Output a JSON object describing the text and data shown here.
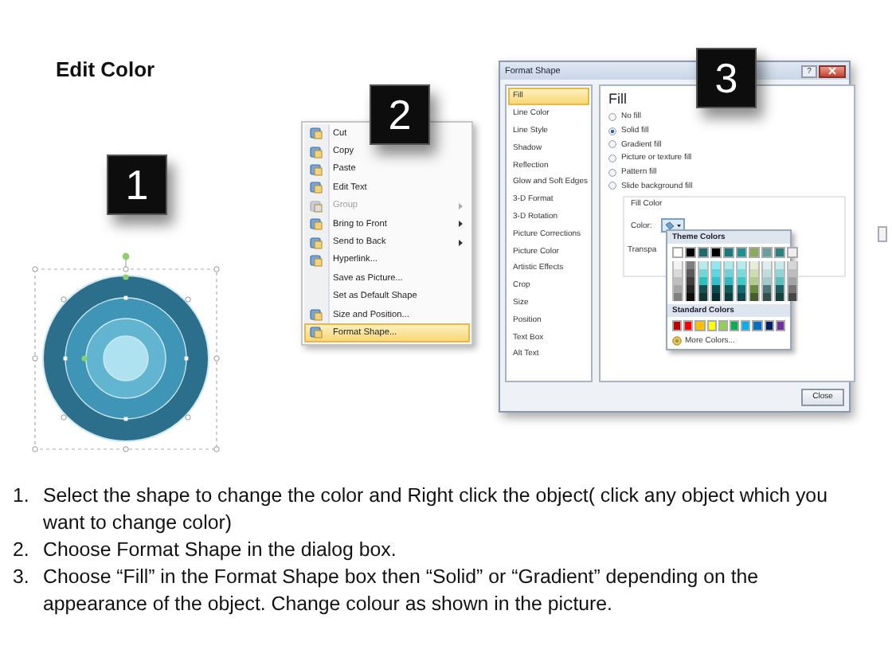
{
  "title": "Edit Color",
  "steps": [
    {
      "number": "1"
    },
    {
      "number": "2"
    },
    {
      "number": "3"
    }
  ],
  "context_menu": {
    "items": [
      {
        "label": "Cut",
        "icon": true,
        "disabled": false,
        "submenu": false,
        "selected": false
      },
      {
        "label": "Copy",
        "icon": true,
        "disabled": false,
        "submenu": false,
        "selected": false
      },
      {
        "label": "Paste",
        "icon": true,
        "disabled": false,
        "submenu": false,
        "selected": false
      },
      {
        "label": "Edit Text",
        "icon": true,
        "disabled": false,
        "submenu": false,
        "selected": false
      },
      {
        "label": "Group",
        "icon": true,
        "disabled": true,
        "submenu": true,
        "selected": false
      },
      {
        "label": "Bring to Front",
        "icon": true,
        "disabled": false,
        "submenu": true,
        "selected": false
      },
      {
        "label": "Send to Back",
        "icon": true,
        "disabled": false,
        "submenu": true,
        "selected": false
      },
      {
        "label": "Hyperlink...",
        "icon": true,
        "disabled": false,
        "submenu": false,
        "selected": false
      },
      {
        "label": "Save as Picture...",
        "icon": false,
        "disabled": false,
        "submenu": false,
        "selected": false
      },
      {
        "label": "Set as Default Shape",
        "icon": false,
        "disabled": false,
        "submenu": false,
        "selected": false
      },
      {
        "label": "Size and Position...",
        "icon": true,
        "disabled": false,
        "submenu": false,
        "selected": false
      },
      {
        "label": "Format Shape...",
        "icon": true,
        "disabled": false,
        "submenu": false,
        "selected": true
      }
    ]
  },
  "dialog": {
    "title": "Format Shape",
    "help_button": "?",
    "sidebar": [
      {
        "label": "Fill",
        "selected": true
      },
      {
        "label": "Line Color",
        "selected": false
      },
      {
        "label": "Line Style",
        "selected": false
      },
      {
        "label": "Shadow",
        "selected": false
      },
      {
        "label": "Reflection",
        "selected": false
      },
      {
        "label": "Glow and Soft Edges",
        "selected": false
      },
      {
        "label": "3-D Format",
        "selected": false
      },
      {
        "label": "3-D Rotation",
        "selected": false
      },
      {
        "label": "Picture Corrections",
        "selected": false
      },
      {
        "label": "Picture Color",
        "selected": false
      },
      {
        "label": "Artistic Effects",
        "selected": false
      },
      {
        "label": "Crop",
        "selected": false
      },
      {
        "label": "Size",
        "selected": false
      },
      {
        "label": "Position",
        "selected": false
      },
      {
        "label": "Text Box",
        "selected": false
      },
      {
        "label": "Alt Text",
        "selected": false
      }
    ],
    "heading": "Fill",
    "options": [
      {
        "label": "No fill",
        "selected": false
      },
      {
        "label": "Solid fill",
        "selected": true
      },
      {
        "label": "Gradient fill",
        "selected": false
      },
      {
        "label": "Picture or texture fill",
        "selected": false
      },
      {
        "label": "Pattern fill",
        "selected": false
      },
      {
        "label": "Slide background fill",
        "selected": false
      }
    ],
    "fill_color_label": "Fill Color",
    "color_label": "Color:",
    "transparency_label": "Transpa",
    "palette": {
      "theme_heading": "Theme Colors",
      "theme_colors": [
        {
          "color": "#ffffff",
          "shades": [
            {
              "color": "#f2f2f2"
            },
            {
              "color": "#d9d9d9"
            },
            {
              "color": "#bfbfbf"
            },
            {
              "color": "#a6a6a6"
            },
            {
              "color": "#808080"
            }
          ]
        },
        {
          "color": "#000000",
          "shades": [
            {
              "color": "#7f7f7f"
            },
            {
              "color": "#595959"
            },
            {
              "color": "#3f3f3f"
            },
            {
              "color": "#262626"
            },
            {
              "color": "#0d0d0d"
            }
          ]
        },
        {
          "color": "#1e6b6b",
          "shades": [
            {
              "color": "#b9eaea"
            },
            {
              "color": "#73d5d5"
            },
            {
              "color": "#2dc0c0"
            },
            {
              "color": "#165050"
            },
            {
              "color": "#0f3535"
            }
          ]
        },
        {
          "color": "#000000",
          "shades": [
            {
              "color": "#8ee8f0"
            },
            {
              "color": "#5dd5e0"
            },
            {
              "color": "#30c0d0"
            },
            {
              "color": "#0a4a50"
            },
            {
              "color": "#052a30"
            }
          ]
        },
        {
          "color": "#1a7878",
          "shades": [
            {
              "color": "#b0e8ec"
            },
            {
              "color": "#70d0d8"
            },
            {
              "color": "#30b8c0"
            },
            {
              "color": "#135a5a"
            },
            {
              "color": "#0c3c3c"
            }
          ]
        },
        {
          "color": "#1d9090",
          "shades": [
            {
              "color": "#b4ecec"
            },
            {
              "color": "#78dada"
            },
            {
              "color": "#3cc8c8"
            },
            {
              "color": "#166c6c"
            },
            {
              "color": "#0e4848"
            }
          ]
        },
        {
          "color": "#8aac5a",
          "shades": [
            {
              "color": "#e6eed8"
            },
            {
              "color": "#cddcb2"
            },
            {
              "color": "#b3cb8c"
            },
            {
              "color": "#6a8a40"
            },
            {
              "color": "#465c2a"
            }
          ]
        },
        {
          "color": "#6a9e9e",
          "shades": [
            {
              "color": "#e0eded"
            },
            {
              "color": "#c2dcdc"
            },
            {
              "color": "#a3caca"
            },
            {
              "color": "#4f7777"
            },
            {
              "color": "#354f4f"
            }
          ]
        },
        {
          "color": "#2b8080",
          "shades": [
            {
              "color": "#c8eaea"
            },
            {
              "color": "#90d4d4"
            },
            {
              "color": "#58bfbf"
            },
            {
              "color": "#206060"
            },
            {
              "color": "#154040"
            }
          ]
        },
        {
          "color": "#eeeeee",
          "shades": [
            {
              "color": "#d6d6d6"
            },
            {
              "color": "#bdbdbd"
            },
            {
              "color": "#a3a3a3"
            },
            {
              "color": "#757575"
            },
            {
              "color": "#474747"
            }
          ]
        }
      ],
      "standard_heading": "Standard Colors",
      "standard_colors": [
        {
          "color": "#c00000"
        },
        {
          "color": "#ff0000"
        },
        {
          "color": "#ffc000"
        },
        {
          "color": "#ffff00"
        },
        {
          "color": "#92d050"
        },
        {
          "color": "#00b050"
        },
        {
          "color": "#00b0f0"
        },
        {
          "color": "#0070c0"
        },
        {
          "color": "#002060"
        },
        {
          "color": "#7030a0"
        }
      ],
      "more_colors": "More Colors..."
    },
    "close_button": "Close"
  },
  "instructions": [
    {
      "number": "1.",
      "text": "Select the shape to change the color and Right click the object( click any object which you want to change color)"
    },
    {
      "number": "2.",
      "text": "Choose Format Shape in the dialog box."
    },
    {
      "number": "3.",
      "text": "Choose “Fill” in the Format Shape box then “Solid” or “Gradient” depending on the appearance of the object. Change colour as shown in the picture."
    }
  ]
}
